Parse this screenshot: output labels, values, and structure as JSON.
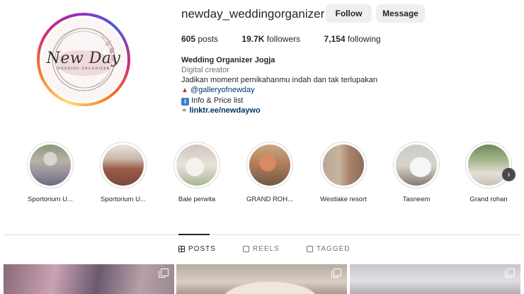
{
  "profile": {
    "username": "newday_weddingorganizer",
    "follow_label": "Follow",
    "message_label": "Message",
    "avatar_logo": {
      "title": "New Day",
      "subtitle": "WEDDING ORGANIZER"
    },
    "stats": {
      "posts": {
        "value": "605",
        "label": "posts"
      },
      "followers": {
        "value": "19.7K",
        "label": "followers"
      },
      "following": {
        "value": "7,154",
        "label": "following"
      }
    },
    "bio": {
      "name": "Wedding Organizer Jogja",
      "category": "Digital creator",
      "line1": "Jadikan moment pernikahanmu indah dan tak terlupakan",
      "mention": "@galleryofnewday",
      "line3": "Info & Price list",
      "link": "linktr.ee/newdaywo"
    }
  },
  "highlights": [
    {
      "label": "Sportorium U..."
    },
    {
      "label": "Sportorium U..."
    },
    {
      "label": "Bale perwita"
    },
    {
      "label": "GRAND ROH..."
    },
    {
      "label": "Westlake resort"
    },
    {
      "label": "Tasneem"
    },
    {
      "label": "Grand rohan"
    }
  ],
  "tabs": [
    {
      "label": "POSTS",
      "icon": "grid-icon",
      "active": true
    },
    {
      "label": "REELS",
      "icon": "reels-icon",
      "active": false
    },
    {
      "label": "TAGGED",
      "icon": "tagged-icon",
      "active": false
    }
  ],
  "colors": {
    "link": "#00376b",
    "button_bg": "#efefef",
    "muted": "#737373",
    "divider": "#dbdbdb"
  }
}
